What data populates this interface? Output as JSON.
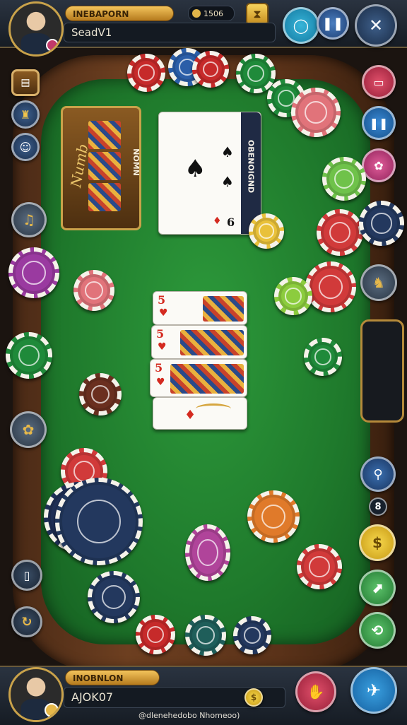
{
  "player_top": {
    "name": "INEBAPORN",
    "coins": "1506",
    "status": "SeadV1"
  },
  "player_bottom": {
    "name": "INOBNLON",
    "balance": "AJOK07"
  },
  "footer_text": "@dlenehedobo Nhomeoo)",
  "slot_card_text": "Numb",
  "slot_card_label": "NOMN",
  "big_card": {
    "rank": "6",
    "side_text": "OBENOIGND"
  },
  "cards": [
    {
      "rank": "5",
      "suit": "♥"
    },
    {
      "rank": "5",
      "suit": "♥"
    },
    {
      "rank": "5",
      "suit": "♥"
    },
    {
      "rank": "",
      "suit": "♦"
    }
  ],
  "right_badge": "8",
  "icons": {
    "hourglass": "hourglass-icon",
    "coin": "coin-icon",
    "chat": "chat-icon",
    "pause": "pause-icon",
    "close": "close-icon"
  },
  "colors": {
    "felt": "#1f7a2c",
    "rail": "#6d3f20",
    "gold": "#c9a24a"
  }
}
